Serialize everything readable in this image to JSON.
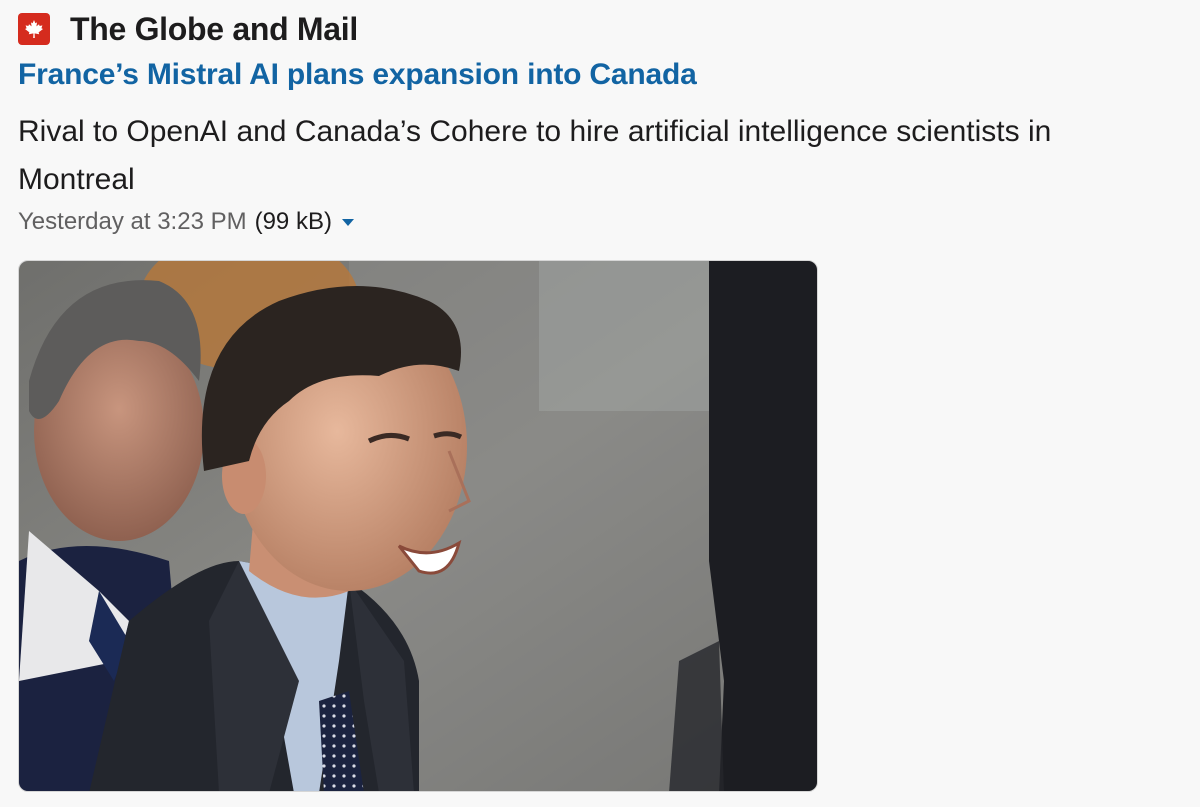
{
  "source": {
    "name": "The Globe and Mail",
    "logo_icon": "maple-leaf-icon",
    "logo_color": "#d52b1e"
  },
  "headline": "France’s Mistral AI plans expansion into Canada",
  "description": "Rival to OpenAI and Canada’s Cohere to hire artificial intelligence scientists in Montreal",
  "meta": {
    "timestamp": "Yesterday at 3:23 PM",
    "file_size": "(99 kB)",
    "toggle_icon": "caret-down-icon"
  },
  "colors": {
    "link": "#1264a3",
    "text": "#1d1c1d",
    "muted": "#616061",
    "background": "#f8f8f8"
  }
}
